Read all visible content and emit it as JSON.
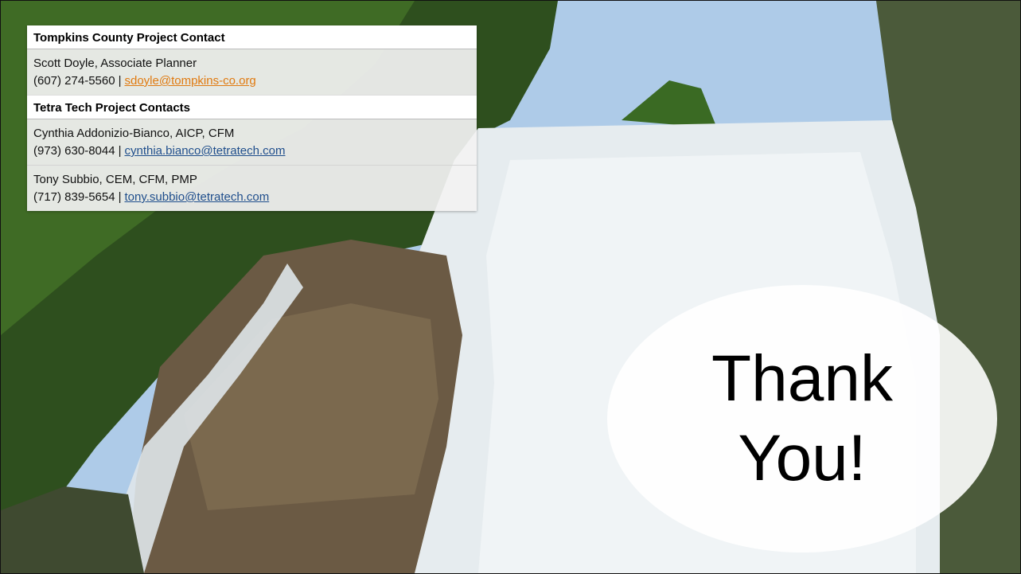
{
  "colors": {
    "link_primary": "#e07a10",
    "link_secondary": "#1f4e8c",
    "panel_bg": "#f2f2f2"
  },
  "background": {
    "icon": "waterfall-photo"
  },
  "contacts": {
    "county_header": "Tompkins County Project Contact",
    "county": {
      "name": "Scott Doyle, Associate Planner",
      "phone": "(607) 274-5560",
      "separator": "|",
      "email": "sdoyle@tompkins-co.org"
    },
    "tetra_header": "Tetra Tech Project Contacts",
    "tetra": [
      {
        "name": "Cynthia Addonizio-Bianco, AICP, CFM",
        "phone": "(973) 630-8044",
        "separator": "|",
        "email": "cynthia.bianco@tetratech.com"
      },
      {
        "name": "Tony Subbio, CEM, CFM, PMP",
        "phone": "(717) 839-5654",
        "separator": "|",
        "email": "tony.subbio@tetratech.com"
      }
    ]
  },
  "bubble": {
    "line1": "Thank",
    "line2": "You!"
  }
}
